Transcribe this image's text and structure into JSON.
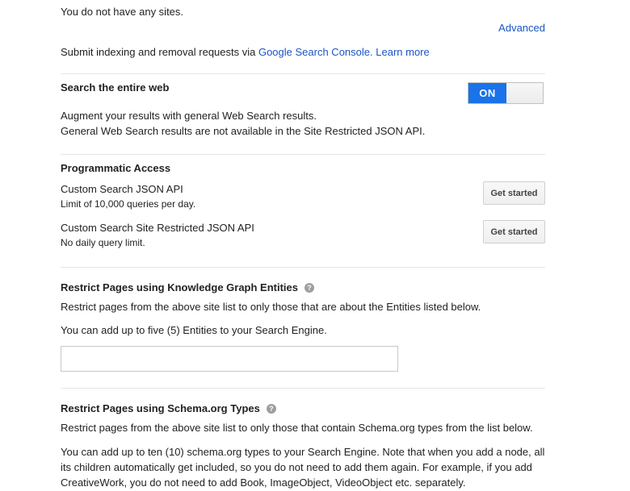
{
  "sites": {
    "empty_message": "You do not have any sites.",
    "advanced_link": "Advanced"
  },
  "indexing": {
    "prefix": "Submit indexing and removal requests via ",
    "console_link": "Google Search Console.",
    "learn_more": "Learn more"
  },
  "search_web": {
    "title": "Search the entire web",
    "toggle_label": "ON",
    "line1": "Augment your results with general Web Search results.",
    "line2": "General Web Search results are not available in the Site Restricted JSON API."
  },
  "programmatic": {
    "title": "Programmatic Access",
    "apis": [
      {
        "name": "Custom Search JSON API",
        "description": "Limit of 10,000 queries per day.",
        "button": "Get started"
      },
      {
        "name": "Custom Search Site Restricted JSON API",
        "description": "No daily query limit.",
        "button": "Get started"
      }
    ]
  },
  "knowledge_graph": {
    "title": "Restrict Pages using Knowledge Graph Entities",
    "help_icon": "?",
    "description": "Restrict pages from the above site list to only those that are about the Entities listed below.",
    "limit": "You can add up to five (5) Entities to your Search Engine.",
    "input_value": ""
  },
  "schema": {
    "title": "Restrict Pages using Schema.org Types",
    "help_icon": "?",
    "description": "Restrict pages from the above site list to only those that contain Schema.org types from the list below.",
    "limit_line1": "You can add up to ten (10) schema.org types to your Search Engine. Note that when you add a node, all",
    "limit_line2": "its children automatically get included, so you do not need to add them again. For example, if you add",
    "limit_line3": "CreativeWork, you do not need to add Book, ImageObject, VideoObject etc. separately."
  },
  "colors": {
    "link": "#1a55c4",
    "toggle_on": "#1a73e8",
    "divider": "#e5e5e5",
    "text": "#222222"
  }
}
